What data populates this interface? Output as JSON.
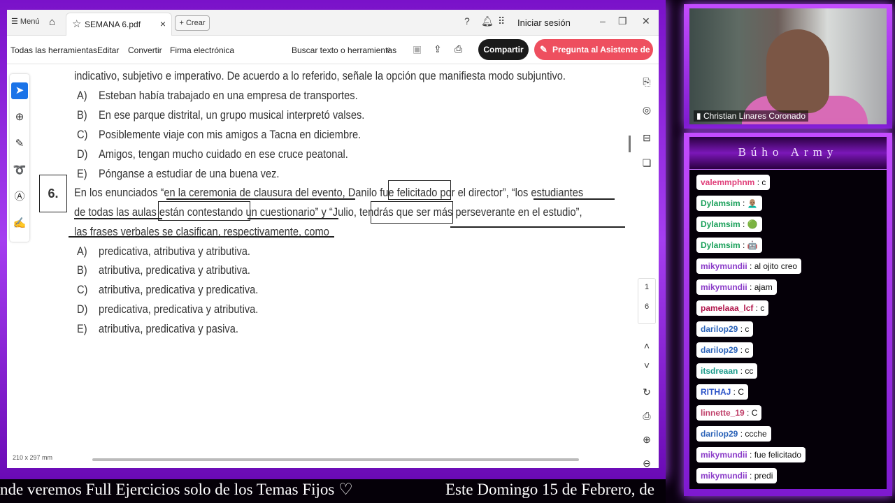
{
  "pdf": {
    "menu_label": "Menú",
    "tab_title": "SEMANA 6.pdf",
    "create_label": "Crear",
    "signin_label": "Iniciar sesión",
    "toolbar": {
      "all_tools": "Todas las herramientas",
      "edit": "Editar",
      "convert": "Convertir",
      "esign": "Firma electrónica",
      "search": "Buscar texto o herramientas",
      "share": "Compartir",
      "ai": "Pregunta al Asistente de IA"
    },
    "page_dims": "210 x 297 mm",
    "page_current": "1",
    "page_total": "6",
    "doc": {
      "intro": "indicativo, subjetivo e imperativo. De acuerdo a lo referido, señale la opción que manifiesta modo subjuntivo.",
      "q5_options": [
        {
          "letter": "A)",
          "text": "Esteban había trabajado en una empresa de transportes."
        },
        {
          "letter": "B)",
          "text": "En ese parque distrital, un grupo musical interpretó valses."
        },
        {
          "letter": "C)",
          "text": "Posiblemente viaje con mis amigos a Tacna en diciembre."
        },
        {
          "letter": "D)",
          "text": "Amigos, tengan mucho cuidado en ese cruce peatonal."
        },
        {
          "letter": "E)",
          "text": "Pónganse a estudiar de una buena vez."
        }
      ],
      "q6_number": "6.",
      "q6_line1": "En los enunciados “en la ceremonia de clausura del evento, Danilo fue felicitado por el director”, “los estudiantes",
      "q6_line2": "de todas las aulas están contestando un cuestionario” y “Julio, tendrás que ser más perseverante en el estudio”,",
      "q6_line3": "las frases verbales se clasifican, respectivamente, como",
      "q6_options": [
        {
          "letter": "A)",
          "text": "predicativa, atributiva y atributiva."
        },
        {
          "letter": "B)",
          "text": "atributiva, predicativa y atributiva."
        },
        {
          "letter": "C)",
          "text": "atributiva, predicativa y predicativa."
        },
        {
          "letter": "D)",
          "text": "predicativa, predicativa y atributiva."
        },
        {
          "letter": "E)",
          "text": "atributiva, predicativa y pasiva."
        }
      ]
    }
  },
  "webcam": {
    "name": "Christian Linares Coronado"
  },
  "chat": {
    "title": "Búho Army",
    "messages": [
      {
        "user": "valemmphnm",
        "text": "c",
        "color": "#e0407a"
      },
      {
        "user": "Dylamsim",
        "text": "👨🏽‍🦲",
        "color": "#1aa05a"
      },
      {
        "user": "Dylamsim",
        "text": "🟢",
        "color": "#1aa05a"
      },
      {
        "user": "Dylamsim",
        "text": "🤖",
        "color": "#1aa05a"
      },
      {
        "user": "mikymundii",
        "text": "al ojito creo",
        "color": "#8a3ac8"
      },
      {
        "user": "mikymundii",
        "text": "ajam",
        "color": "#8a3ac8"
      },
      {
        "user": "pamelaaa_lcf",
        "text": "c",
        "color": "#b0144a"
      },
      {
        "user": "darilop29",
        "text": "c",
        "color": "#2a62b8"
      },
      {
        "user": "darilop29",
        "text": "c",
        "color": "#2a62b8"
      },
      {
        "user": "itsdreaan",
        "text": "cc",
        "color": "#1a9a8a"
      },
      {
        "user": "RITHAJ",
        "text": "C",
        "color": "#2a52c8"
      },
      {
        "user": "linnette_19",
        "text": "C",
        "color": "#c0406a"
      },
      {
        "user": "darilop29",
        "text": "ccche",
        "color": "#2a62b8"
      },
      {
        "user": "mikymundii",
        "text": "fue felicitado",
        "color": "#8a3ac8"
      },
      {
        "user": "mikymundii",
        "text": "predi",
        "color": "#8a3ac8"
      }
    ]
  },
  "ticker": {
    "part1": "nde veremos Full Ejercicios solo de los Temas Fijos ♡",
    "part2": "Este Domingo 15 de Febrero, de"
  }
}
